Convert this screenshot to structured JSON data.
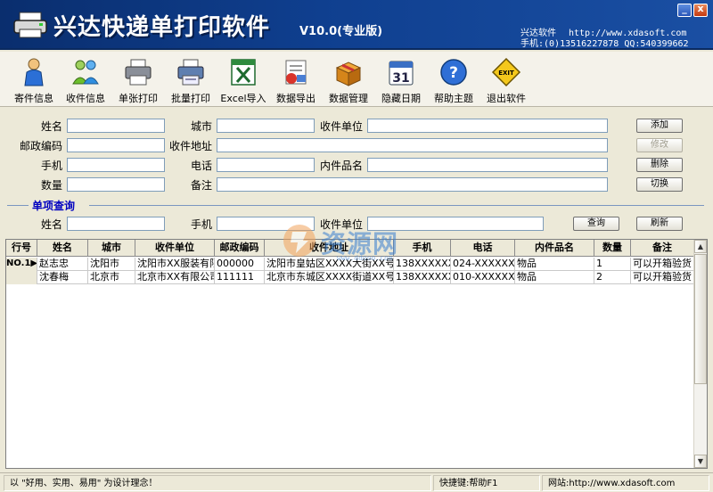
{
  "window": {
    "title": "兴达快递单打印软件",
    "version": "V10.0(专业版)",
    "brand_name": "兴达软件",
    "brand_url": "http://www.xdasoft.com",
    "phone_line": "手机:(0)13516227878 QQ:540399662",
    "minimize_glyph": "_",
    "close_glyph": "x"
  },
  "toolbar": [
    {
      "label": "寄件信息",
      "icon": "person-icon"
    },
    {
      "label": "收件信息",
      "icon": "people-icon"
    },
    {
      "label": "单张打印",
      "icon": "printer-icon"
    },
    {
      "label": "批量打印",
      "icon": "batch-printer-icon"
    },
    {
      "label": "Excel导入",
      "icon": "excel-icon"
    },
    {
      "label": "数据导出",
      "icon": "export-icon"
    },
    {
      "label": "数据管理",
      "icon": "box-icon"
    },
    {
      "label": "隐藏日期",
      "icon": "calendar-icon"
    },
    {
      "label": "帮助主题",
      "icon": "help-icon"
    },
    {
      "label": "退出软件",
      "icon": "exit-icon"
    }
  ],
  "calendar_day": "31",
  "exit_sign": "EXIT",
  "form": {
    "name_label": "姓名",
    "city_label": "城市",
    "recv_unit_label": "收件单位",
    "zip_label": "邮政编码",
    "recv_addr_label": "收件地址",
    "mobile_label": "手机",
    "phone_label": "电话",
    "item_label": "内件品名",
    "qty_label": "数量",
    "note_label": "备注",
    "add_button": "添加",
    "edit_button": "修改",
    "delete_button": "删除",
    "switch_button": "切换"
  },
  "query": {
    "section_title": "单项查询",
    "name_label": "姓名",
    "mobile_label": "手机",
    "recv_unit_label": "收件单位",
    "search_button": "查询",
    "refresh_button": "刷新"
  },
  "grid": {
    "columns": [
      "行号",
      "姓名",
      "城市",
      "收件单位",
      "邮政编码",
      "收件地址",
      "手机",
      "电话",
      "内件品名",
      "数量",
      "备注"
    ],
    "rows": [
      {
        "rowno": "NO.1▶",
        "cells": [
          "赵志忠",
          "沈阳市",
          "沈阳市XX服装有限",
          "000000",
          "沈阳市皇姑区XXXX大街XX号",
          "138XXXXXXX0",
          "024-XXXXXXXX",
          "物品",
          "1",
          "可以开箱验货"
        ]
      },
      {
        "rowno": "",
        "cells": [
          "沈春梅",
          "北京市",
          "北京市XX有限公司",
          "111111",
          "北京市东城区XXXX街道XX号",
          "138XXXXXXX1",
          "010-XXXXXXXX",
          "物品",
          "2",
          "可以开箱验货"
        ]
      }
    ]
  },
  "watermark": {
    "text": "资源网",
    "sub": "www.ddooo.com"
  },
  "status": {
    "slogan": "以 \"好用、实用、易用\" 为设计理念！",
    "hotkey": "快捷键:帮助F1",
    "website": "网站:http://www.xdasoft.com"
  },
  "colors": {
    "titlebar": "#0f3f8f",
    "section_title": "#0000c0"
  }
}
